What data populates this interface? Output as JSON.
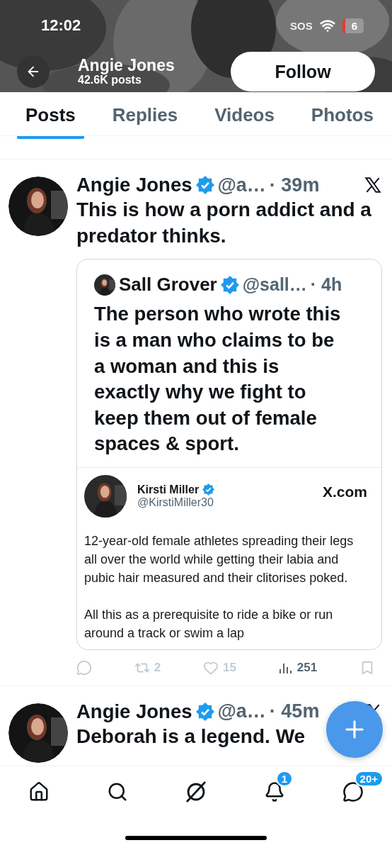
{
  "status_bar": {
    "time": "12:02",
    "sos": "SOS",
    "battery": "6"
  },
  "profile_header": {
    "name": "Angie Jones",
    "posts_count": "42.6K posts",
    "follow_button": "Follow"
  },
  "tabs": [
    {
      "label": "Posts",
      "selected": true
    },
    {
      "label": "Replies",
      "selected": false
    },
    {
      "label": "Videos",
      "selected": false
    },
    {
      "label": "Photos",
      "selected": false
    }
  ],
  "posts": [
    {
      "author": "Angie Jones",
      "verified": true,
      "handle": "@a…",
      "time": "· 39m",
      "text": "This is how a porn addict and a predator thinks.",
      "quote": {
        "author": "Sall Grover",
        "verified": true,
        "handle": "@sall…",
        "time": "· 4h",
        "text": "The person who wrote this is a man who claims to be a woman and this is exactly why we fight to keep them out of female spaces & sport.",
        "embed": {
          "author": "Kirsti Miller",
          "verified": true,
          "handle": "@KirstiMiller30",
          "site": "X.com",
          "paragraphs": [
            "12-year-old female athletes spreading their legs all over the world while getting their labia and pubic hair measured and their clitorises poked.",
            "All this as a prerequisite to ride a bike or run around a track or swim a lap"
          ]
        }
      },
      "actions": {
        "retweets": "2",
        "likes": "15",
        "views": "251"
      }
    },
    {
      "author": "Angie Jones",
      "verified": true,
      "handle": "@a…",
      "time": "· 45m",
      "text": "Deborah is a legend. We"
    }
  ],
  "nav": [
    {
      "kind": "home"
    },
    {
      "kind": "search"
    },
    {
      "kind": "slash"
    },
    {
      "kind": "bell",
      "badge": "1"
    },
    {
      "kind": "chat",
      "badge": "20+"
    }
  ]
}
